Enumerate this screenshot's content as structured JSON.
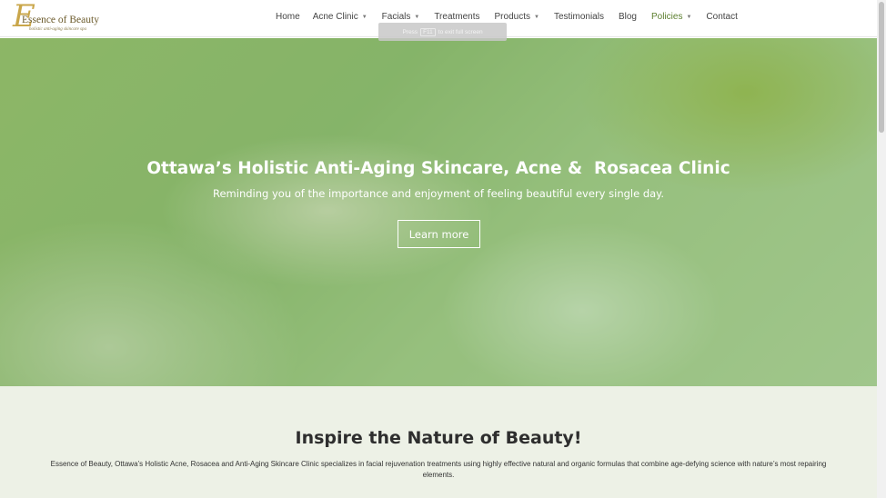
{
  "header": {
    "logo_initial": "E",
    "logo_name": "Essence of Beauty",
    "logo_tagline": "holistic anti-aging skincare spa"
  },
  "nav": {
    "items": [
      {
        "label": "Home",
        "dropdown": false
      },
      {
        "label": "Acne Clinic",
        "dropdown": true
      },
      {
        "label": "Facials",
        "dropdown": true
      },
      {
        "label": "Treatments",
        "dropdown": false
      },
      {
        "label": "Products",
        "dropdown": true
      },
      {
        "label": "Testimonials",
        "dropdown": false
      },
      {
        "label": "Blog",
        "dropdown": false
      },
      {
        "label": "Policies",
        "dropdown": true
      },
      {
        "label": "Contact",
        "dropdown": false
      }
    ],
    "active_item": "Policies",
    "chevron_icon": "chevron-down-icon"
  },
  "fullscreen_hint": {
    "press": "Press",
    "key": "F11",
    "rest": "to exit full screen"
  },
  "hero": {
    "title": "Ottawa’s Holistic Anti-Aging Skincare, Acne &  Rosacea Clinic",
    "subtitle": "Reminding you of the importance and enjoyment of feeling beautiful every single day.",
    "button_label": "Learn more"
  },
  "intro": {
    "title": "Inspire the Nature of Beauty!",
    "text": "Essence of Beauty, Ottawa’s Holistic Acne, Rosacea and Anti-Aging Skincare Clinic specializes in facial rejuvenation treatments using highly effective natural and organic formulas that combine age-defying science with nature’s most repairing elements."
  },
  "colors": {
    "accent_green": "#5c7f2e",
    "logo_gold": "#c9a64a",
    "intro_bg": "#edf1e6",
    "hero_tint": "#62a048"
  }
}
